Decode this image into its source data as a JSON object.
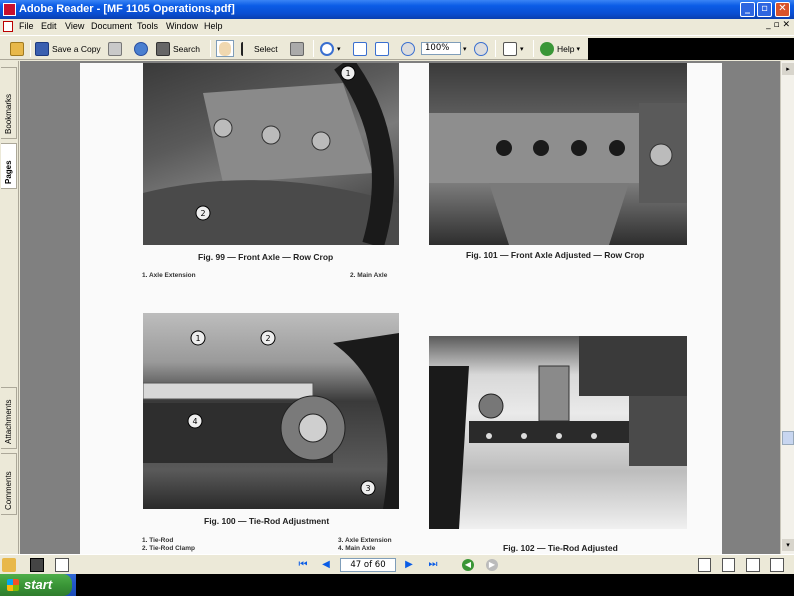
{
  "window": {
    "title": "Adobe Reader - [MF 1105 Operations.pdf]",
    "controls": {
      "minimize": "_",
      "maximize": "▫",
      "close": "✕"
    }
  },
  "menu": {
    "items": [
      "File",
      "Edit",
      "View",
      "Document",
      "Tools",
      "Window",
      "Help"
    ],
    "doc_controls": "_ ▫ ✕"
  },
  "toolbar": {
    "save_copy": "Save a Copy",
    "search": "Search",
    "select": "Select",
    "zoom": "100%",
    "help": "Help"
  },
  "nav_tabs": {
    "bookmarks": "Bookmarks",
    "pages": "Pages",
    "attachments": "Attachments",
    "comments": "Comments"
  },
  "document": {
    "figures": {
      "fig99": {
        "caption": "Fig. 99 — Front Axle — Row Crop",
        "callouts": [
          "1",
          "2"
        ],
        "legend_left": "1.  Axle Extension",
        "legend_right": "2.  Main Axle"
      },
      "fig101": {
        "caption": "Fig. 101 — Front Axle Adjusted — Row Crop"
      },
      "fig100": {
        "caption": "Fig. 100 — Tie-Rod Adjustment",
        "callouts": [
          "1",
          "2",
          "3",
          "4"
        ],
        "legend_left_1": "1.  Tie-Rod",
        "legend_left_2": "2.  Tie-Rod Clamp",
        "legend_right_1": "3.  Axle Extension",
        "legend_right_2": "4.  Main Axle"
      },
      "fig102": {
        "caption": "Fig. 102 — Tie-Rod Adjusted"
      }
    }
  },
  "status": {
    "page_display": "47 of 60"
  },
  "taskbar": {
    "start_label": "start"
  },
  "colors": {
    "titlebar": "#0b5ce6",
    "chrome": "#ece9d8",
    "doc_background": "#808080",
    "start_green": "#3a9637"
  }
}
